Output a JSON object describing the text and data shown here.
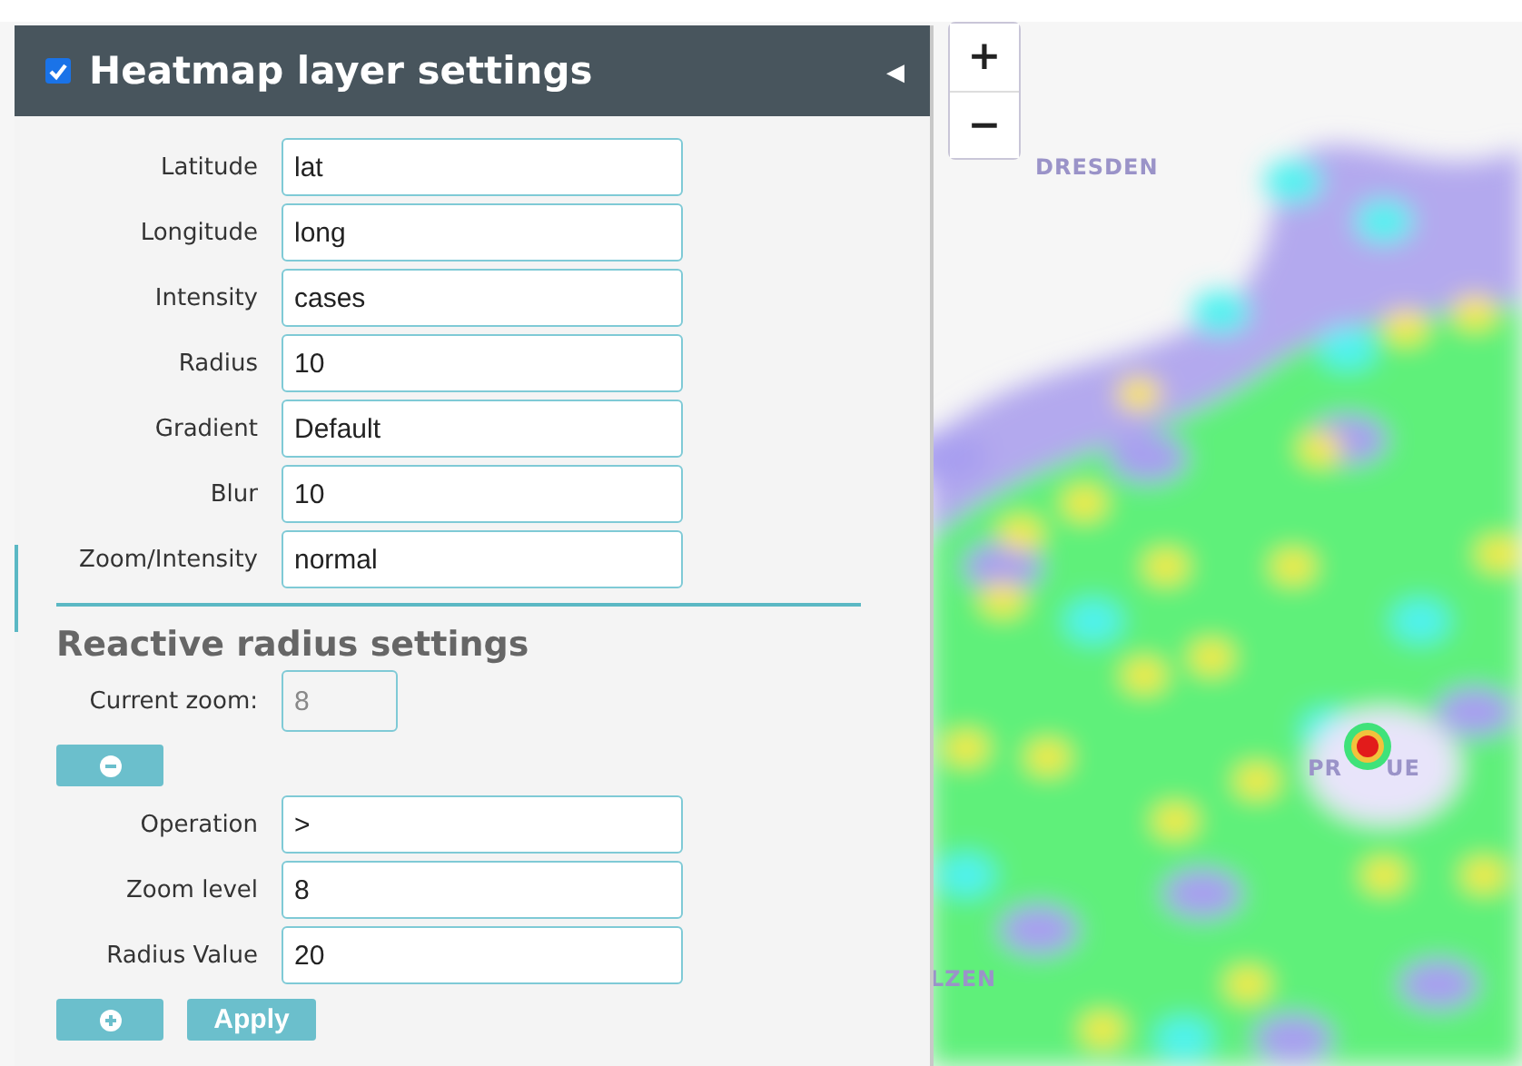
{
  "panel": {
    "title": "Heatmap layer settings",
    "enabled": true,
    "collapse_icon": "◀",
    "fields": [
      {
        "label": "Latitude",
        "value": "lat"
      },
      {
        "label": "Longitude",
        "value": "long"
      },
      {
        "label": "Intensity",
        "value": "cases"
      },
      {
        "label": "Radius",
        "value": "10"
      },
      {
        "label": "Gradient",
        "value": "Default"
      },
      {
        "label": "Blur",
        "value": "10"
      },
      {
        "label": "Zoom/Intensity",
        "value": "normal"
      }
    ],
    "reactive": {
      "title": "Reactive radius settings",
      "current_zoom": {
        "label": "Current zoom:",
        "value": "8",
        "disabled": true
      },
      "rules": [
        {
          "label": "Operation",
          "value": ">"
        },
        {
          "label": "Zoom level",
          "value": "8"
        },
        {
          "label": "Radius Value",
          "value": "20"
        }
      ],
      "apply_button": "Apply"
    }
  },
  "map": {
    "zoom_in": "+",
    "zoom_out": "−",
    "labels": [
      {
        "text": "DRESDEN"
      },
      {
        "text": "PR"
      },
      {
        "text": "UE"
      },
      {
        "text": "LZEN"
      }
    ]
  }
}
